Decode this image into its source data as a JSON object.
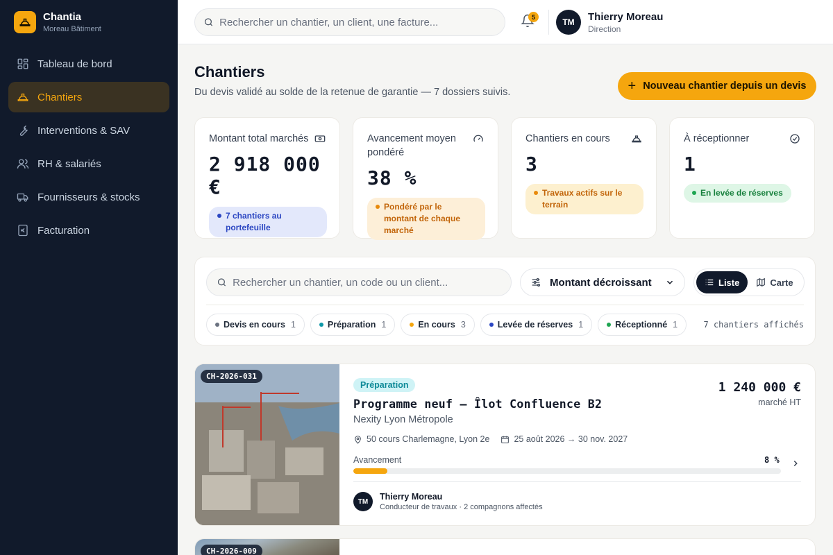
{
  "app": {
    "name": "Chantia",
    "company": "Moreau Bâtiment"
  },
  "nav": [
    {
      "label": "Tableau de bord",
      "icon": "dashboard-icon"
    },
    {
      "label": "Chantiers",
      "icon": "hardhat-icon",
      "active": true
    },
    {
      "label": "Interventions & SAV",
      "icon": "wrench-icon"
    },
    {
      "label": "RH & salariés",
      "icon": "users-icon"
    },
    {
      "label": "Fournisseurs & stocks",
      "icon": "truck-icon"
    },
    {
      "label": "Facturation",
      "icon": "euro-icon"
    }
  ],
  "header": {
    "search_placeholder": "Rechercher un chantier, un client, une facture...",
    "notifications": "5",
    "user": {
      "initials": "TM",
      "name": "Thierry Moreau",
      "role": "Direction"
    }
  },
  "page": {
    "title": "Chantiers",
    "subtitle": "Du devis validé au solde de la retenue de garantie — 7 dossiers suivis.",
    "new_button": "Nouveau chantier depuis un devis"
  },
  "kpis": [
    {
      "label": "Montant total marchés",
      "value": "2 918 000 €",
      "pill": "7 chantiers au portefeuille",
      "icon": "cash-icon",
      "pill_bg": "#e3e8fb",
      "pill_fg": "#2b46c2",
      "dot": "#2b46c2"
    },
    {
      "label": "Avancement moyen pondéré",
      "value": "38 %",
      "pill": "Pondéré par le montant de chaque marché",
      "icon": "gauge-icon",
      "pill_bg": "#fdefd8",
      "pill_fg": "#c2650a",
      "dot": "#e88a0c"
    },
    {
      "label": "Chantiers en cours",
      "value": "3",
      "pill": "Travaux actifs sur le terrain",
      "icon": "hardhat-icon",
      "pill_bg": "#fdf0cf",
      "pill_fg": "#c2650a",
      "dot": "#e88a0c"
    },
    {
      "label": "À réceptionner",
      "value": "1",
      "pill": "En levée de réserves",
      "icon": "check-circle-icon",
      "pill_bg": "#def6e6",
      "pill_fg": "#17803d",
      "dot": "#1ea551"
    }
  ],
  "filters": {
    "search_placeholder": "Rechercher un chantier, un code ou un client...",
    "sort": "Montant décroissant",
    "view_list": "Liste",
    "view_map": "Carte",
    "chips": [
      {
        "label": "Devis en cours",
        "count": "1",
        "dot": "#6b7280"
      },
      {
        "label": "Préparation",
        "count": "1",
        "dot": "#0e98a8"
      },
      {
        "label": "En cours",
        "count": "3",
        "dot": "#f5a60e"
      },
      {
        "label": "Levée de réserves",
        "count": "1",
        "dot": "#2b46c2"
      },
      {
        "label": "Réceptionné",
        "count": "1",
        "dot": "#1ea551"
      }
    ],
    "shown": "7 chantiers affichés"
  },
  "projects": [
    {
      "code": "CH-2026-031",
      "status": "Préparation",
      "title": "Programme neuf — Îlot Confluence B2",
      "client": "Nexity Lyon Métropole",
      "amount": "1 240 000 €",
      "amount_unit": "marché HT",
      "address": "50 cours Charlemagne, Lyon 2e",
      "dates": "25 août 2026 → 30 nov. 2027",
      "progress_label": "Avancement",
      "progress": 8,
      "progress_text": "8 %",
      "manager": {
        "initials": "TM",
        "name": "Thierry Moreau",
        "role": "Conducteur de travaux · 2 compagnons affectés"
      }
    },
    {
      "code": "CH-2026-009"
    }
  ],
  "colors": {
    "accent": "#f5a60e",
    "sidebar": "#111a2b"
  }
}
